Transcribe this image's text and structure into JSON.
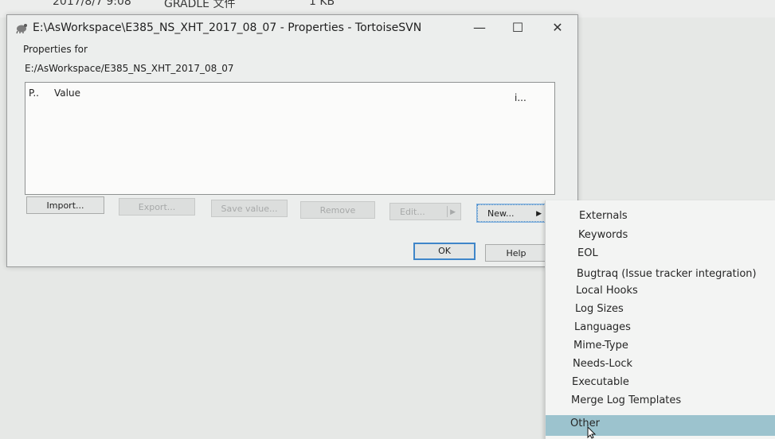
{
  "background": {
    "date_text": "2017/8/7 9:08",
    "type_text": "GRADLE 文件",
    "size_text": "1 KB"
  },
  "window": {
    "title": "E:\\AsWorkspace\\E385_NS_XHT_2017_08_07 - Properties - TortoiseSVN",
    "controls": {
      "minimize": "—",
      "maximize": "☐",
      "close": "✕"
    },
    "properties_for_label": "Properties for",
    "path": "E:/AsWorkspace/E385_NS_XHT_2017_08_07",
    "list": {
      "columns": [
        "P..",
        "Value",
        "i..."
      ]
    },
    "buttons": {
      "import": "Import...",
      "export": "Export...",
      "save_value": "Save value...",
      "remove": "Remove",
      "edit": "Edit...",
      "new": "New...",
      "ok": "OK",
      "help": "Help"
    }
  },
  "new_menu": {
    "items": [
      "Externals",
      "Keywords",
      "EOL",
      "Bugtraq (Issue tracker integration)",
      "Local Hooks",
      "Log Sizes",
      "Languages",
      "Mime-Type",
      "Needs-Lock",
      "Executable",
      "Merge Log Templates",
      "Other"
    ],
    "highlighted": "Other",
    "highlight_color": "#9cc3ce"
  },
  "colors": {
    "accent": "#3f86c9",
    "disabled_text": "#a7a9a9"
  }
}
